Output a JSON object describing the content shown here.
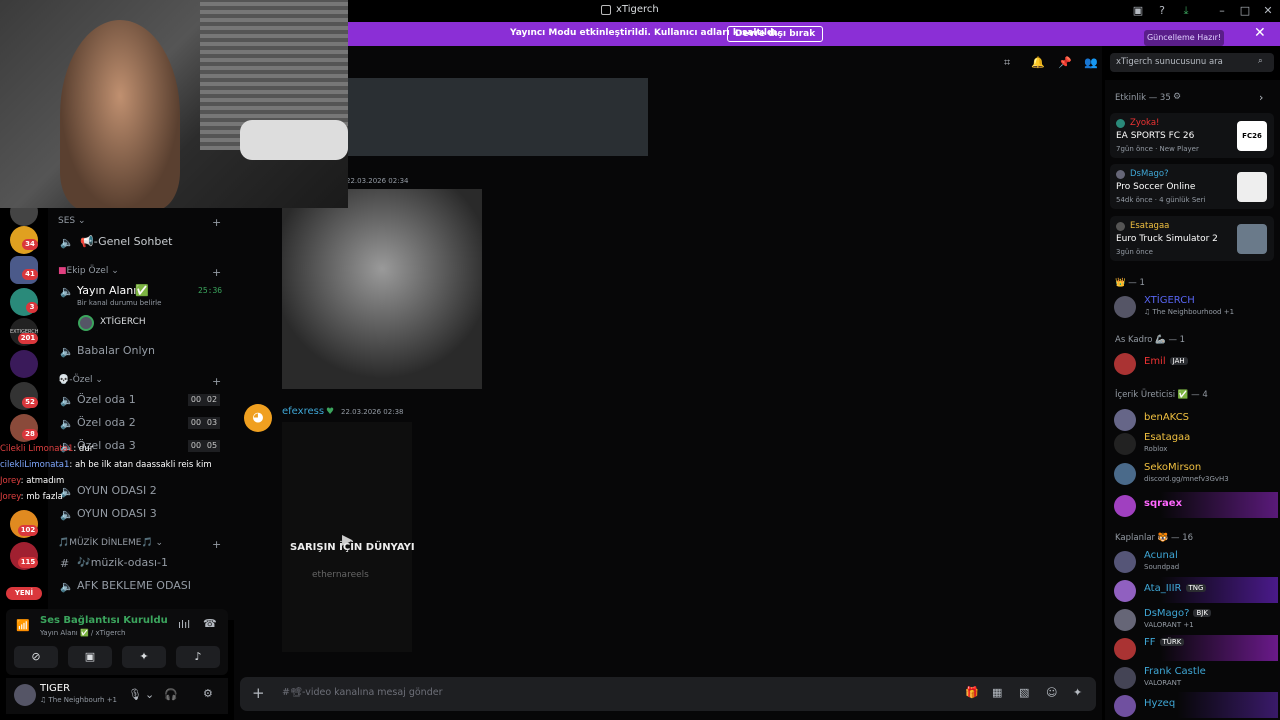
{
  "window": {
    "title": "xTigerch"
  },
  "banner": {
    "text": "Yayıncı Modu etkinleştirildi. Kullanıcı adları kısaltıldı.",
    "button": "Devre dışı bırak",
    "tooltip": "Güncelleme Hazır!"
  },
  "servers": {
    "badges": [
      "34",
      "41",
      "3",
      "201",
      "52",
      "28",
      "102",
      "115"
    ],
    "new_label": "YENİ",
    "text_label": "EXTIGERCH"
  },
  "channels": {
    "cat_ses": "SES",
    "genel": "📢-Genel Sohbet",
    "cat_ekip": "Ekip Özel",
    "yayin": "Yayın Alanı",
    "yayin_status": "Bir kanal durumu belirle",
    "yayin_time": "25:36",
    "yayin_user": "XTİGERCH",
    "babalar": "Babalar Onlyn",
    "cat_ozel": "-Özel",
    "oda1": "Özel oda 1",
    "oda1_a": "00",
    "oda1_b": "02",
    "oda2": "Özel oda 2",
    "oda2_a": "00",
    "oda2_b": "03",
    "oda3": "Özel oda 3",
    "oda3_a": "00",
    "oda3_b": "05",
    "oyun2": "OYUN ODASI 2",
    "oyun3": "OYUN ODASI 3",
    "cat_muzik": "🎵MÜZİK DİNLEME🎵",
    "muzik": "🎶müzik-odası-1",
    "afk": "AFK BEKLEME ODASI"
  },
  "overlay_chat": [
    {
      "user": "Cilekli Limonata1",
      "text": ": dur"
    },
    {
      "user": "cilekliLimonata1",
      "text": ": ah be ilk atan daassakli reis kim"
    },
    {
      "user": "Jorey",
      "text": ": atmadım"
    },
    {
      "user": "Jorey",
      "text": ": mb fazla"
    }
  ],
  "voice": {
    "title": "Ses Bağlantısı Kuruldu",
    "subtitle": "Yayın Alanı ✅ / xTigerch"
  },
  "user": {
    "name": "TIGER",
    "status": "♫ The Neighbourh +1"
  },
  "messages": [
    {
      "ts": "22.03.2026 02:34"
    },
    {
      "author": "efexress",
      "ts": "22.03.2026 02:38",
      "video_text": "SARIŞIN İÇİN DÜNYAYI",
      "video_credit": "ethernareels"
    }
  ],
  "composer": {
    "placeholder": "#📽-video kanalına mesaj gönder"
  },
  "search": {
    "placeholder": "xTigerch sunucusunu ara"
  },
  "members": {
    "activity_header": "Etkinlik — 35",
    "activities": [
      {
        "who": "Zyoka!",
        "game": "EA SPORTS FC 26",
        "meta": "7gün önce · New Player",
        "thumb": "FC26"
      },
      {
        "who": "DsMago?",
        "game": "Pro Soccer Online",
        "meta": "54dk önce · 4 günlük Seri",
        "thumb": ""
      },
      {
        "who": "Esatagaa",
        "game": "Euro Truck Simulator 2",
        "meta": "3gün önce",
        "thumb": ""
      }
    ],
    "sections": [
      {
        "header": "👑 — 1",
        "list": [
          {
            "name": "XTİGERCH",
            "status": "♫ The Neighbourhood +1",
            "color": "#5865f2"
          }
        ]
      },
      {
        "header": "As Kadro 🦾 — 1",
        "list": [
          {
            "name": "Emil",
            "tag": "JAH",
            "status": "",
            "color": "#e33"
          }
        ]
      },
      {
        "header": "İçerik Üreticisi ✅ — 4",
        "list": [
          {
            "name": "benAKCS",
            "status": "",
            "color": "#f0c040"
          },
          {
            "name": "Esatagaa",
            "status": "Roblox",
            "color": "#f0c040"
          },
          {
            "name": "SekoMirson",
            "status": "discord.gg/mnefv3GvH3",
            "color": "#f0c040"
          },
          {
            "name": "sqraex",
            "status": "",
            "color": "#ff66ff"
          }
        ]
      },
      {
        "header": "Kaplanlar 🐯 — 16",
        "list": [
          {
            "name": "Acunal",
            "status": "Soundpad",
            "color": "#3fa7d6"
          },
          {
            "name": "Ata_IIIR",
            "tag": "TNG",
            "status": "",
            "color": "#3fa7d6"
          },
          {
            "name": "DsMago?",
            "tag": "BJK",
            "status": "VALORANT +1",
            "color": "#3fa7d6"
          },
          {
            "name": "FF",
            "tag": "TÜRK",
            "status": "",
            "color": "#3fa7d6"
          },
          {
            "name": "Frank Castle",
            "status": "VALORANT",
            "color": "#3fa7d6"
          },
          {
            "name": "Hyzeq",
            "status": "",
            "color": "#3fa7d6"
          }
        ]
      }
    ]
  }
}
